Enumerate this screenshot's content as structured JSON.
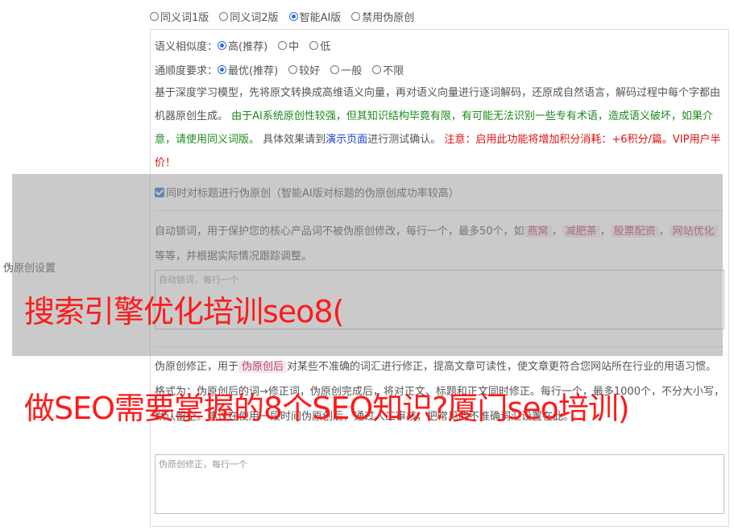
{
  "modes": [
    {
      "label": "同义词1版",
      "selected": false
    },
    {
      "label": "同义词2版",
      "selected": false
    },
    {
      "label": "智能AI版",
      "selected": true
    },
    {
      "label": "禁用伪原创",
      "selected": false
    }
  ],
  "similarity": {
    "label": "语义相似度：",
    "options": [
      {
        "label": "高(推荐)",
        "selected": true
      },
      {
        "label": "中",
        "selected": false
      },
      {
        "label": "低",
        "selected": false
      }
    ]
  },
  "fluency": {
    "label": "通顺度要求：",
    "options": [
      {
        "label": "最优(推荐)",
        "selected": true
      },
      {
        "label": "较好",
        "selected": false
      },
      {
        "label": "一般",
        "selected": false
      },
      {
        "label": "不限",
        "selected": false
      }
    ]
  },
  "description": {
    "part1": "基于深度学习模型，先将原文转换成高维语义向量，再对语义向量进行逐词解码，还原成自然语言，解码过程中每个字都由机器原创生成。",
    "green": "由于AI系统原创性较强，但其知识结构毕竟有限，有可能无法识别一些专有术语，造成语义破坏，如果介意，请使用同义词版。",
    "part2": "具体效果请到",
    "link": "演示页面",
    "part3": "进行测试确认。",
    "red": "注意：启用此功能将增加积分消耗：+6积分/篇。VIP用户半价！"
  },
  "title_checkbox": {
    "label": "同时对标题进行伪原创（智能AI版对标题的伪原创成功率较高）",
    "checked": true
  },
  "section_label": "伪原创设置",
  "lock": {
    "text1": "自动锁词，用于保护您的核心产品词不被伪原创修改，每行一个，最多50个，如",
    "tags": [
      "燕窝",
      "减肥茶",
      "股票配资",
      "网站优化"
    ],
    "text2": "等等，并根据实际情况跟踪调整。",
    "placeholder": "自动锁词，每行一个"
  },
  "correction": {
    "text1": "伪原创修正，用于",
    "tag": "伪原创后",
    "text2": "对某些不准确的词汇进行修正，提高文章可读性，使文章更符合您网站所在行业的用语习惯。格式为：伪原创后的词→修正词，伪原创完成后，将对正文、标题和正文同时修正。每行一个，最多1000个，不分大小写，默认留空。建议在使用一段时间伪原创后，通过人工审核，把常见的不准确词汇设置在此。",
    "placeholder": "伪原创修正，每行一个"
  },
  "watermark": {
    "line1": "搜索引擎优化培训seo8(",
    "line2": "做SEO需要掌握的8个SEO知识?厦门seo培训)"
  },
  "colors": {
    "accent": "#2f6fdc",
    "green": "#1c8a1c",
    "red": "#e01010",
    "watermark": "#ff1a1a"
  }
}
